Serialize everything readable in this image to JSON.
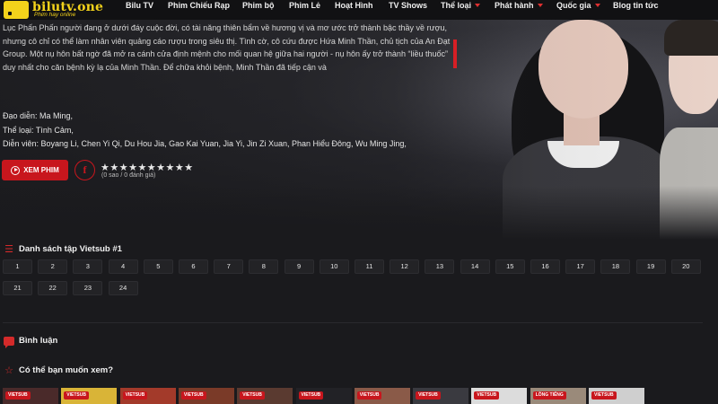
{
  "header": {
    "logo_main": "bilutv.one",
    "logo_sub": "Phim hay online",
    "nav": [
      {
        "label": "Bilu TV",
        "dropdown": false
      },
      {
        "label": "Phim Chiếu Rạp",
        "dropdown": false
      },
      {
        "label": "Phim bộ",
        "dropdown": false
      },
      {
        "label": "Phim Lẻ",
        "dropdown": false
      },
      {
        "label": "Hoạt Hình",
        "dropdown": false
      },
      {
        "label": "TV Shows",
        "dropdown": false
      },
      {
        "label": "Thể loại",
        "dropdown": true
      },
      {
        "label": "Phát hành",
        "dropdown": true
      },
      {
        "label": "Quốc gia",
        "dropdown": true
      },
      {
        "label": "Blog tin tức",
        "dropdown": false
      }
    ]
  },
  "hero": {
    "description": "Lục Phấn Phấn người đang ở dưới đáy cuộc đời, có tài năng thiên bẩm về hương vị và mơ ước trở thành bậc thầy về rượu, nhưng cô chỉ có thể làm nhân viên quảng cáo rượu trong siêu thị. Tình cờ, cô cứu được Hứa Minh Thần, chủ tịch của An Đạt Group. Một nụ hôn bất ngờ đã mở ra cánh cửa định mệnh cho mối quan hệ giữa hai người - nụ hôn ấy trở thành “liều thuốc” duy nhất cho căn bệnh kỳ lạ của Minh Thần. Để chữa khỏi bệnh, Minh Thần đã tiếp cận và",
    "director": "Đạo diễn: Ma Ming,",
    "genre": "Thể loại: Tình Cảm,",
    "cast": "Diễn viên: Boyang Li, Chen Yi Qi, Du Hou Jia, Gao Kai Yuan, Jia Yi, Jin Zi Xuan, Phan Hiểu Đông, Wu Ming Jing,",
    "watch_button": "XEM PHIM",
    "facebook_label": "f",
    "stars": "★★★★★★★★★★",
    "rating_text": "(0 sao / 0 đánh giá)"
  },
  "episodes": {
    "title": "Danh sách tập Vietsub #1",
    "items": [
      "1",
      "2",
      "3",
      "4",
      "5",
      "6",
      "7",
      "8",
      "9",
      "10",
      "11",
      "12",
      "13",
      "14",
      "15",
      "16",
      "17",
      "18",
      "19",
      "20",
      "21",
      "22",
      "23",
      "24"
    ]
  },
  "comments": {
    "title": "Bình luận"
  },
  "suggestions": {
    "title": "Có thể bạn muốn xem?",
    "items": [
      {
        "tag": "VIETSUB",
        "color": "#4a2a2a"
      },
      {
        "tag": "VIETSUB",
        "color": "#d9b437"
      },
      {
        "tag": "VIETSUB",
        "color": "#a33a2a"
      },
      {
        "tag": "VIETSUB",
        "color": "#7a3a28"
      },
      {
        "tag": "VIETSUB",
        "color": "#5a3a30"
      },
      {
        "tag": "VIETSUB",
        "color": "#222226"
      },
      {
        "tag": "VIETSUB",
        "color": "#8a5a48"
      },
      {
        "tag": "VIETSUB",
        "color": "#3a3a40"
      },
      {
        "tag": "VIETSUB",
        "color": "#dcdcdc"
      },
      {
        "tag": "LỒNG TIẾNG",
        "color": "#9a8a7a"
      },
      {
        "tag": "VIETSUB",
        "color": "#cfcfcf"
      }
    ]
  },
  "colors": {
    "accent": "#c8161d",
    "logo": "#f3d21b",
    "background": "#1a1a1d"
  }
}
